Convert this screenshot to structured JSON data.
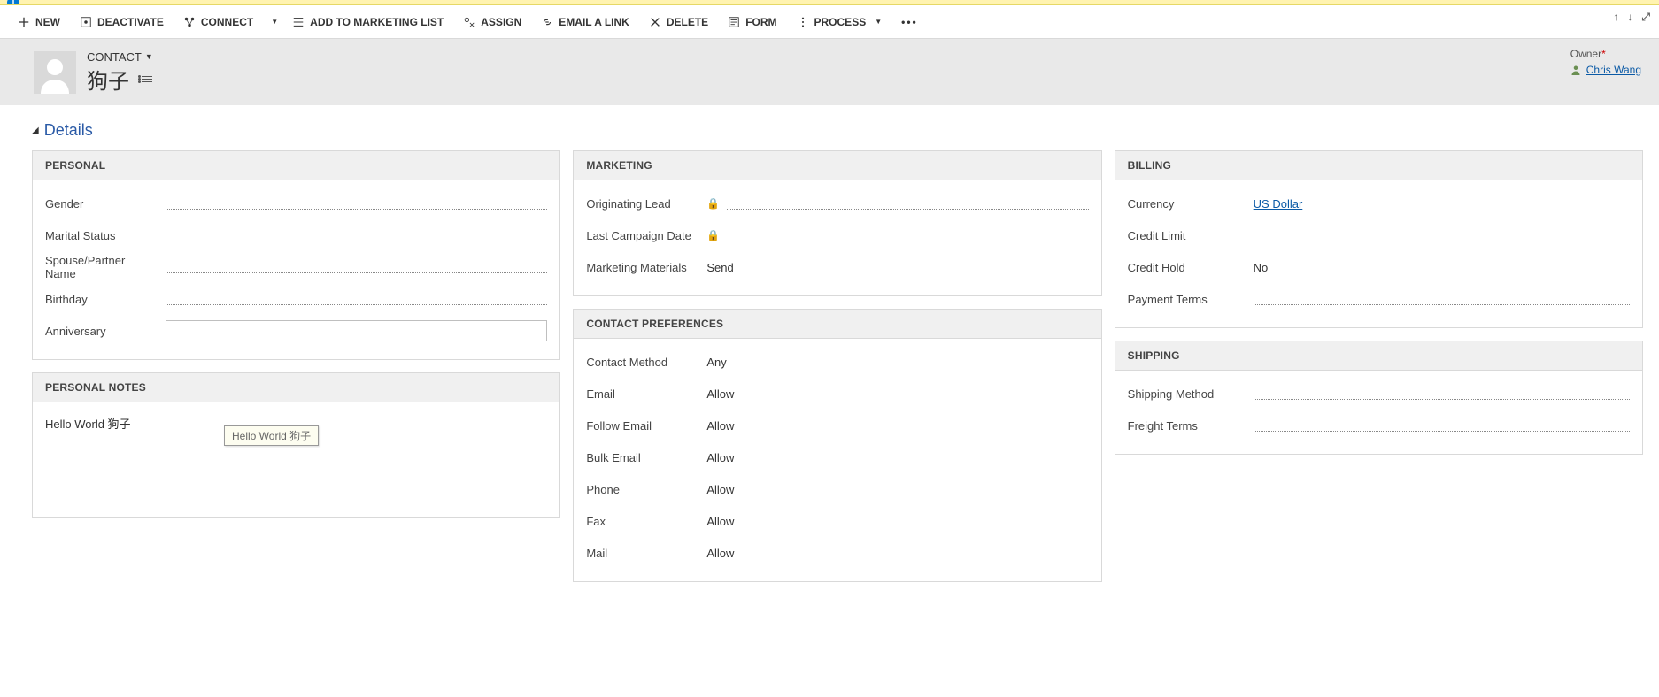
{
  "entity_label": "CONTACT",
  "record_name": "狗子",
  "owner": {
    "label": "Owner",
    "value": "Chris Wang"
  },
  "commands": {
    "new": "NEW",
    "deactivate": "DEACTIVATE",
    "connect": "CONNECT",
    "add_to_marketing": "ADD TO MARKETING LIST",
    "assign": "ASSIGN",
    "email_link": "EMAIL A LINK",
    "delete": "DELETE",
    "form": "FORM",
    "process": "PROCESS"
  },
  "section_title": "Details",
  "panels": {
    "personal": {
      "title": "PERSONAL",
      "fields": {
        "gender": "Gender",
        "marital_status": "Marital Status",
        "spouse": "Spouse/Partner Name",
        "birthday": "Birthday",
        "anniversary": "Anniversary"
      }
    },
    "personal_notes": {
      "title": "PERSONAL NOTES",
      "value": "Hello World 狗子",
      "tooltip": "Hello World 狗子"
    },
    "marketing": {
      "title": "MARKETING",
      "fields": {
        "originating_lead": "Originating Lead",
        "last_campaign": "Last Campaign Date",
        "marketing_materials_label": "Marketing Materials",
        "marketing_materials_value": "Send"
      }
    },
    "contact_prefs": {
      "title": "CONTACT PREFERENCES",
      "fields": {
        "contact_method_label": "Contact Method",
        "contact_method_value": "Any",
        "email_label": "Email",
        "email_value": "Allow",
        "follow_email_label": "Follow Email",
        "follow_email_value": "Allow",
        "bulk_email_label": "Bulk Email",
        "bulk_email_value": "Allow",
        "phone_label": "Phone",
        "phone_value": "Allow",
        "fax_label": "Fax",
        "fax_value": "Allow",
        "mail_label": "Mail",
        "mail_value": "Allow"
      }
    },
    "billing": {
      "title": "BILLING",
      "fields": {
        "currency_label": "Currency",
        "currency_value": "US Dollar",
        "credit_limit": "Credit Limit",
        "credit_hold_label": "Credit Hold",
        "credit_hold_value": "No",
        "payment_terms": "Payment Terms"
      }
    },
    "shipping": {
      "title": "SHIPPING",
      "fields": {
        "shipping_method": "Shipping Method",
        "freight_terms": "Freight Terms"
      }
    }
  }
}
